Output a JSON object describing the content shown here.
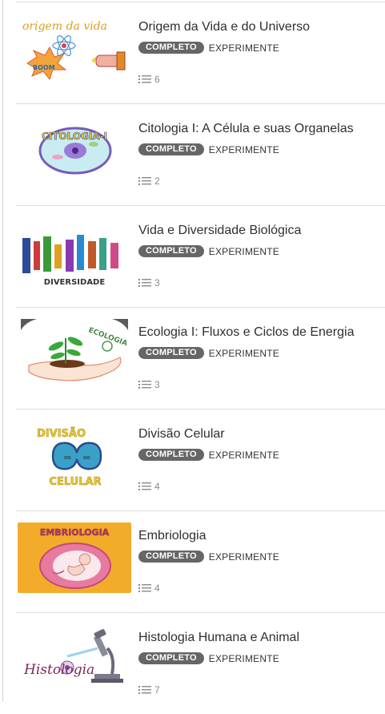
{
  "courses": [
    {
      "title": "Origem da Vida e do Universo",
      "status": "COMPLETO",
      "action": "EXPERIMENTE",
      "lesson_count": "6",
      "thumb_text": "origem da vida",
      "thumb_text_2": "BOOM"
    },
    {
      "title": "Citologia I: A Célula e suas Organelas",
      "status": "COMPLETO",
      "action": "EXPERIMENTE",
      "lesson_count": "2",
      "thumb_text": "CITOLOGIA-I"
    },
    {
      "title": "Vida e Diversidade Biológica",
      "status": "COMPLETO",
      "action": "EXPERIMENTE",
      "lesson_count": "3",
      "thumb_text": "DIVERSIDADE"
    },
    {
      "title": "Ecologia I: Fluxos e Ciclos de Energia",
      "status": "COMPLETO",
      "action": "EXPERIMENTE",
      "lesson_count": "3",
      "thumb_text": "ECOLOGIA"
    },
    {
      "title": "Divisão Celular",
      "status": "COMPLETO",
      "action": "EXPERIMENTE",
      "lesson_count": "4",
      "thumb_text": "DIVISÃO",
      "thumb_text_2": "CELULAR"
    },
    {
      "title": "Embriologia",
      "status": "COMPLETO",
      "action": "EXPERIMENTE",
      "lesson_count": "4",
      "thumb_text": "EMBRIOLOGIA"
    },
    {
      "title": "Histologia Humana e Animal",
      "status": "COMPLETO",
      "action": "EXPERIMENTE",
      "lesson_count": "7",
      "thumb_text": "Histologia"
    }
  ],
  "icons": {
    "lessons": "list-icon"
  },
  "colors": {
    "badge": "#666666",
    "title": "#2f2f2f",
    "divider": "#dcdcdc"
  }
}
